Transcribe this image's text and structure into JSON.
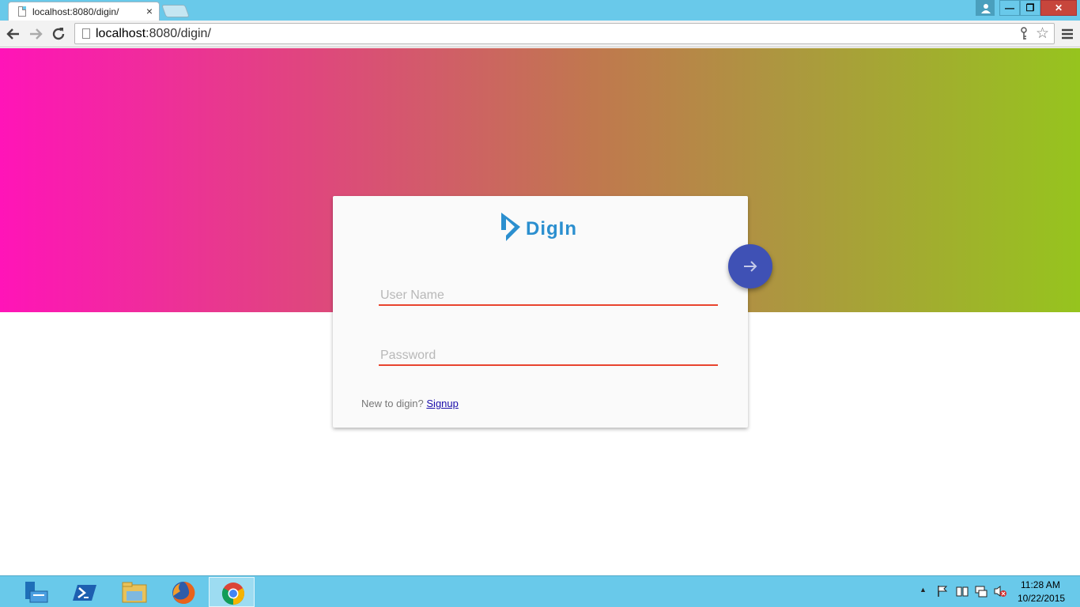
{
  "browser": {
    "tab_title": "localhost:8080/digin/",
    "tab_close": "×",
    "url_host": "localhost",
    "url_rest": ":8080/digin/",
    "window_buttons": {
      "minimize": "—",
      "maximize": "❐",
      "close": "✕",
      "user": "👤"
    }
  },
  "login": {
    "logo_text": "DigIn",
    "username_placeholder": "User Name",
    "password_placeholder": "Password",
    "signup_prompt": "New to digin? ",
    "signup_link": "Signup"
  },
  "colors": {
    "hero_gradient": [
      "#ff14b8",
      "#96c41e"
    ],
    "field_underline": "#e8442e",
    "submit_button": "#3f51b5",
    "logo": "#2b8fcf"
  },
  "taskbar": {
    "items": [
      "server-manager",
      "powershell",
      "file-explorer",
      "firefox",
      "chrome"
    ],
    "active_item": "chrome",
    "clock_time": "11:28 AM",
    "clock_date": "10/22/2015"
  }
}
